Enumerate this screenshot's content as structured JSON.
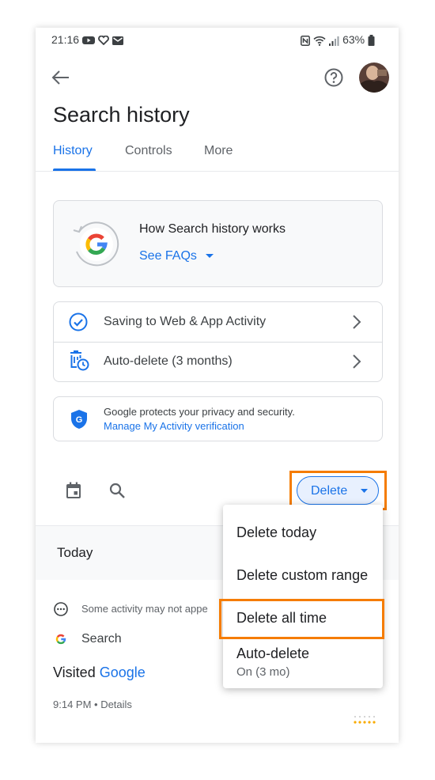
{
  "status_bar": {
    "time": "21:16",
    "battery": "63%"
  },
  "header": {
    "title": "Search history"
  },
  "tabs": [
    {
      "label": "History"
    },
    {
      "label": "Controls"
    },
    {
      "label": "More"
    }
  ],
  "faq_card": {
    "title": "How Search history works",
    "link": "See FAQs"
  },
  "settings": [
    {
      "label": "Saving to Web & App Activity"
    },
    {
      "label": "Auto-delete (3 months)"
    }
  ],
  "privacy": {
    "text": "Google protects your privacy and security.",
    "link": "Manage My Activity verification"
  },
  "toolbar": {
    "delete_label": "Delete"
  },
  "section": {
    "today": "Today"
  },
  "activity": {
    "notice": "Some activity may not appe",
    "product": "Search",
    "visited_prefix": "Visited",
    "visited_link": "Google",
    "meta": "9:14 PM • Details"
  },
  "delete_menu": {
    "items": [
      "Delete today",
      "Delete custom range",
      "Delete all time",
      "Auto-delete"
    ],
    "auto_delete_sub": "On (3 mo)"
  },
  "colors": {
    "accent": "#1a73e8",
    "highlight": "#f57c00"
  }
}
